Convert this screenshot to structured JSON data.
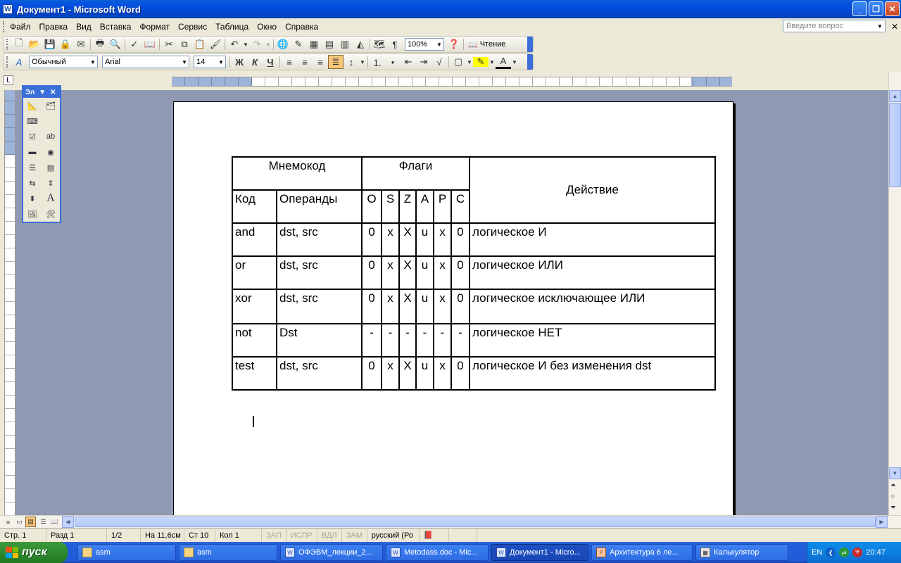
{
  "window": {
    "title": "Документ1 - Microsoft Word",
    "app_icon": "W"
  },
  "menu": {
    "items": [
      "Файл",
      "Правка",
      "Вид",
      "Вставка",
      "Формат",
      "Сервис",
      "Таблица",
      "Окно",
      "Справка"
    ],
    "help_placeholder": "Введите вопрос"
  },
  "toolbar_standard": {
    "zoom": "100%",
    "read_label": "Чтение"
  },
  "toolbar_format": {
    "style": "Обычный",
    "font": "Arial",
    "size": "14",
    "bold": "Ж",
    "italic": "К",
    "underline": "Ч"
  },
  "forms_toolbar": {
    "title": "Эл"
  },
  "table": {
    "header": {
      "mnemonic": "Мнемокод",
      "flags": "Флаги",
      "action": "Действие"
    },
    "subheader": {
      "code": "Код",
      "operands": "Операнды",
      "flags": [
        "O",
        "S",
        "Z",
        "A",
        "P",
        "C"
      ]
    },
    "rows": [
      {
        "code": "and",
        "operands": "dst, src",
        "flags": [
          "0",
          "x",
          "X",
          "u",
          "x",
          "0"
        ],
        "action": "логическое И"
      },
      {
        "code": "or",
        "operands": "dst, src",
        "flags": [
          "0",
          "x",
          "X",
          "u",
          "x",
          "0"
        ],
        "action": "логическое ИЛИ"
      },
      {
        "code": "xor",
        "operands": "dst, src",
        "flags": [
          "0",
          "x",
          "X",
          "u",
          "x",
          "0"
        ],
        "action": "логическое исключающее ИЛИ"
      },
      {
        "code": "not",
        "operands": "Dst",
        "flags": [
          "-",
          "-",
          "-",
          "-",
          "-",
          "-"
        ],
        "action": "логическое НЕТ"
      },
      {
        "code": "test",
        "operands": "dst, src",
        "flags": [
          "0",
          "x",
          "X",
          "u",
          "x",
          "0"
        ],
        "action": "логическое И без изменения dst"
      }
    ]
  },
  "status": {
    "page": "Стр. 1",
    "section": "Разд 1",
    "pages": "1/2",
    "at": "На 11,6см",
    "line": "Ст 10",
    "col": "Кол 1",
    "rec": "ЗАП",
    "trk": "ИСПР",
    "ext": "ВДЛ",
    "ovr": "ЗАМ",
    "lang": "русский (Ро"
  },
  "taskbar": {
    "start": "пуск",
    "tasks": [
      "asm",
      "asm",
      "ОФЭВМ_лекции_2...",
      "Metodass.doc - Mic...",
      "Документ1 - Micro...",
      "Архитектура 6 ле...",
      "Калькулятор"
    ],
    "lang": "EN",
    "clock": "20:47"
  }
}
